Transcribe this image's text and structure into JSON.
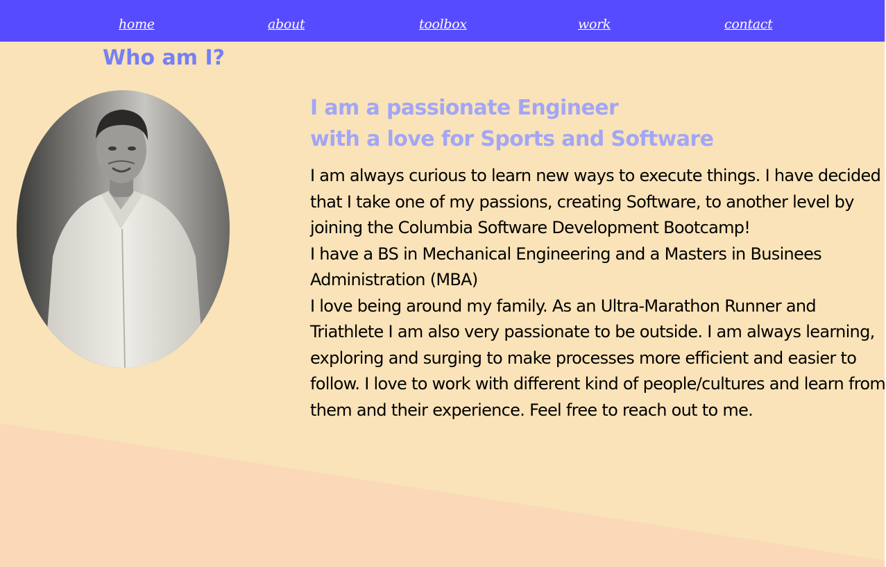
{
  "nav": {
    "items": [
      {
        "label": "home"
      },
      {
        "label": "about"
      },
      {
        "label": "toolbox"
      },
      {
        "label": "work"
      },
      {
        "label": "contact"
      }
    ]
  },
  "about": {
    "title": "Who am I?",
    "headline_line1": "I am a passionate Engineer",
    "headline_line2": "with a love for Sports and Software",
    "paragraphs": [
      "I am always curious to learn new ways to execute things. I have decided that I take one of my passions, creating Software, to another level by joining the Columbia Software Development Bootcamp!",
      "I have a BS in Mechanical Engineering and a Masters in Businees Administration (MBA)",
      "I love being around my family. As an Ultra-Marathon Runner and Triathlete I am also very passionate to be outside. I am always learning, exploring and surging to make processes more efficient and easier to follow. I love to work with different kind of people/cultures and learn from them and their experience. Feel free to reach out to me."
    ]
  },
  "colors": {
    "nav_bg": "#574bff",
    "page_bg": "#fae3b8",
    "bottom_band": "#fad8b8",
    "title": "#7580f5",
    "headline": "#a2a6f6",
    "body_text": "#000000"
  }
}
